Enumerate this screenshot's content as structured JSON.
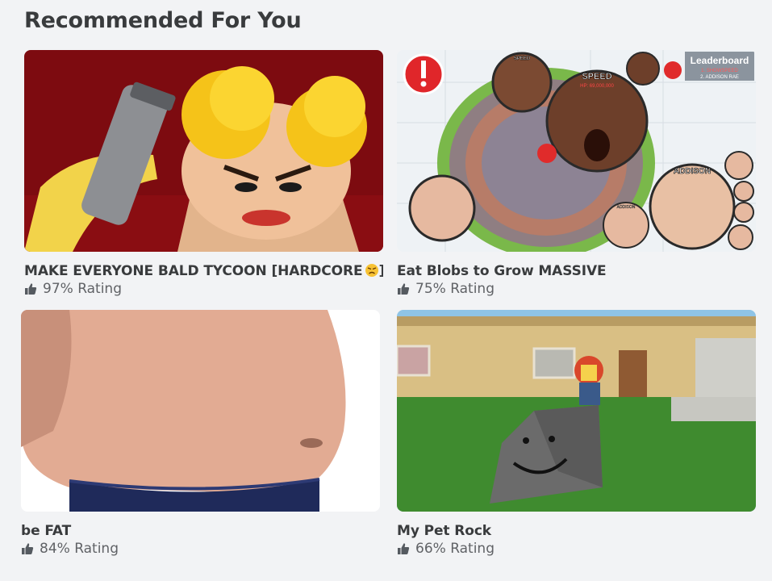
{
  "section": {
    "title": "Recommended For You"
  },
  "games": [
    {
      "name": "MAKE EVERYONE BALD TYCOON [HARDCORE",
      "emoji_icon": "angry-face-emoji-icon",
      "name_suffix": "]",
      "rating": "97% Rating",
      "thumbnail_icon": "bald-tycoon-thumbnail"
    },
    {
      "name": "Eat Blobs to Grow MASSIVE",
      "rating": "75% Rating",
      "thumbnail_icon": "blobs-thumbnail",
      "thumbnail_text": {
        "leaderboard": "Leaderboard",
        "lb_1": "1. SHOWSPEED",
        "lb_2": "2. ADDISON RAE",
        "speed_label": "SPEED",
        "speed_small": "SPEED",
        "hp": "HP: 69,000,000",
        "addison_label": "ADDISON",
        "addison_small": "ADDISON"
      }
    },
    {
      "name": "be FAT",
      "rating": "84% Rating",
      "thumbnail_icon": "belly-thumbnail"
    },
    {
      "name": "My Pet Rock",
      "rating": "66% Rating",
      "thumbnail_icon": "pet-rock-thumbnail"
    }
  ],
  "colors": {
    "background": "#f2f3f5",
    "title": "#393b3d",
    "rating_text": "#606266"
  }
}
